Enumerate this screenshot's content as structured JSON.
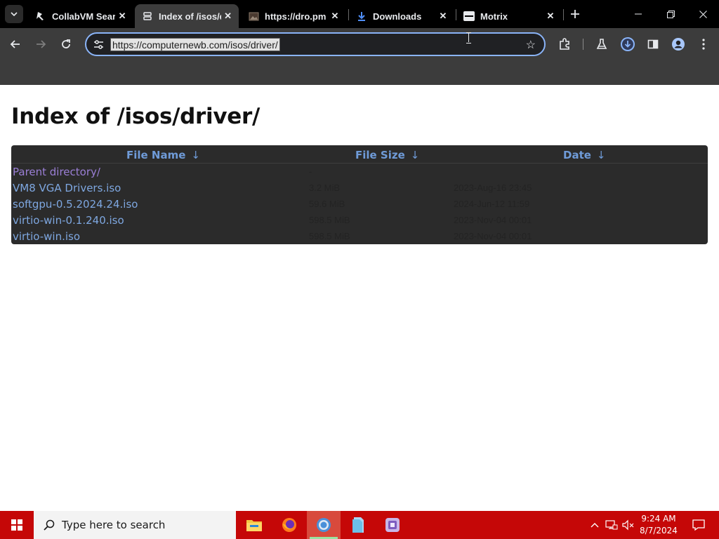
{
  "browser": {
    "tabs": [
      {
        "title": "CollabVM Sear",
        "icon": "collabvm-icon",
        "active": false
      },
      {
        "title": "Index of /isos/d",
        "icon": "server-icon",
        "active": true
      },
      {
        "title": "https://dro.pm",
        "icon": "image-icon",
        "active": false
      },
      {
        "title": "Downloads",
        "icon": "download-icon",
        "active": false
      },
      {
        "title": "Motrix",
        "icon": "motrix-icon",
        "active": false
      }
    ],
    "address_url": "https://computernewb.com/isos/driver/",
    "accent": "#8ab4f8"
  },
  "page": {
    "title": "Index of /isos/driver/",
    "columns": {
      "name": "File Name",
      "size": "File Size",
      "date": "Date",
      "sort_arrow": "↓"
    },
    "rows": [
      {
        "name": "Parent directory/",
        "size": "-",
        "date": "",
        "visited": true
      },
      {
        "name": "VM8 VGA Drivers.iso",
        "size": "3.2 MiB",
        "date": "2023-Aug-16 23:45",
        "visited": false
      },
      {
        "name": "softgpu-0.5.2024.24.iso",
        "size": "59.6 MiB",
        "date": "2024-Jun-12 11:59",
        "visited": false
      },
      {
        "name": "virtio-win-0.1.240.iso",
        "size": "598.5 MiB",
        "date": "2023-Nov-04 00:01",
        "visited": false
      },
      {
        "name": "virtio-win.iso",
        "size": "598.5 MiB",
        "date": "2023-Nov-04 00:01",
        "visited": false
      }
    ]
  },
  "taskbar": {
    "search_placeholder": "Type here to search",
    "apps": [
      "file-explorer-icon",
      "firefox-icon",
      "chrome-icon",
      "files-icon",
      "app-icon"
    ],
    "time": "9:24 AM",
    "date": "8/7/2024",
    "color": "#c50707"
  }
}
